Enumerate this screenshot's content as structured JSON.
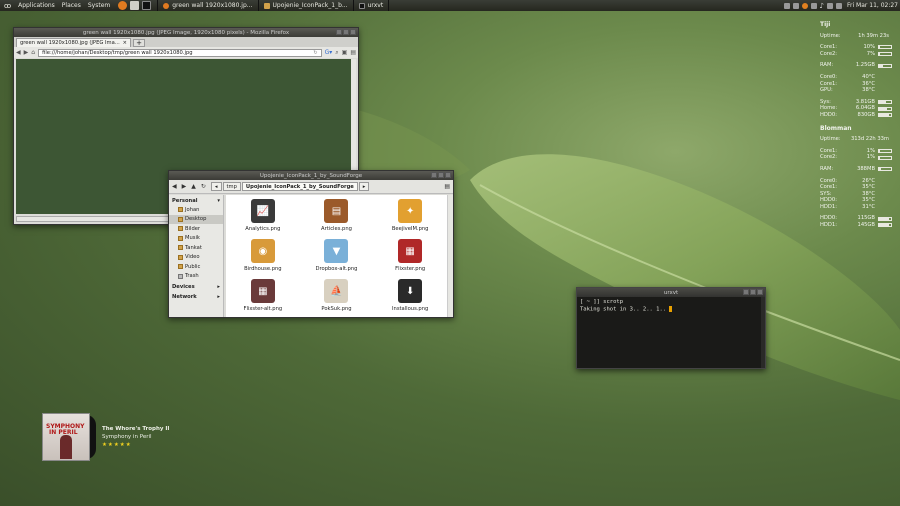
{
  "panel": {
    "menus": [
      "Applications",
      "Places",
      "System"
    ],
    "tasks": [
      "green wall 1920x1080.jp...",
      "Upojenie_IconPack_1_b...",
      "urxvt"
    ],
    "clock": "Fri Mar 11, 02:27"
  },
  "conky": {
    "host1": "Tiji",
    "uptime1_label": "Uptime:",
    "uptime1": "1h 39m 23s",
    "cpu1": [
      {
        "l": "Core1:",
        "v": "10%",
        "p": 0.1
      },
      {
        "l": "Core2:",
        "v": "7%",
        "p": 0.07
      }
    ],
    "ram1": {
      "l": "RAM:",
      "v": "1.25GB",
      "p": 0.3
    },
    "temps1": [
      {
        "l": "Core0:",
        "v": "40°C"
      },
      {
        "l": "Core1:",
        "v": "36°C"
      },
      {
        "l": "GPU:",
        "v": "38°C"
      }
    ],
    "disks1": [
      {
        "l": "Sys:",
        "v": "3.81GB",
        "p": 0.6
      },
      {
        "l": "Home:",
        "v": "6.04GB",
        "p": 0.7
      },
      {
        "l": "HDD0:",
        "v": "830GB",
        "p": 0.85
      }
    ],
    "host2": "Blomman",
    "uptime2_label": "Uptime:",
    "uptime2": "313d 22h 33m",
    "cpu2": [
      {
        "l": "Core1:",
        "v": "1%",
        "p": 0.01
      },
      {
        "l": "Core2:",
        "v": "1%",
        "p": 0.01
      }
    ],
    "ram2": {
      "l": "RAM:",
      "v": "388MB",
      "p": 0.15
    },
    "temps2": [
      {
        "l": "Core0:",
        "v": "26°C"
      },
      {
        "l": "Core1:",
        "v": "35°C"
      },
      {
        "l": "SYS:",
        "v": "38°C"
      },
      {
        "l": "HDD0:",
        "v": "35°C"
      },
      {
        "l": "HDD1:",
        "v": "31°C"
      }
    ],
    "disks2": [
      {
        "l": "HDD0:",
        "v": "115GB",
        "p": 0.8
      },
      {
        "l": "HDD1:",
        "v": "145GB",
        "p": 0.85
      }
    ]
  },
  "firefox": {
    "title": "green wall 1920x1080.jpg (JPEG Image, 1920x1080 pixels) - Mozilla Firefox",
    "tab": "green wall 1920x1080.jpg (JPEG Ima...",
    "url": "file:///home/johan/Desktop/tmp/green wall 1920x1080.jpg",
    "newtab": "+"
  },
  "nautilus": {
    "title": "Upojenie_IconPack_1_by_SoundForge",
    "crumbs": [
      "tmp",
      "Upojenie_IconPack_1_by_SoundForge"
    ],
    "sections": [
      "Personal",
      "Devices",
      "Network"
    ],
    "places": [
      "Johan",
      "Desktop",
      "Bilder",
      "Musik",
      "Tankat",
      "Video",
      "Public",
      "Trash"
    ],
    "files": [
      {
        "name": "Analytics.png",
        "color": "#3a3a3a",
        "glyph": "📈"
      },
      {
        "name": "Articles.png",
        "color": "#9b5a2a",
        "glyph": "▤"
      },
      {
        "name": "BeejiveIM.png",
        "color": "#e2a030",
        "glyph": "✦"
      },
      {
        "name": "Birdhouse.png",
        "color": "#d89a3a",
        "glyph": "◉"
      },
      {
        "name": "Dropbox-alt.png",
        "color": "#7ab0d8",
        "glyph": "▼"
      },
      {
        "name": "Flixster.png",
        "color": "#b02828",
        "glyph": "▦"
      },
      {
        "name": "Flixster-alt.png",
        "color": "#6a3a3a",
        "glyph": "▦"
      },
      {
        "name": "PokSuk.png",
        "color": "#d8d0c0",
        "glyph": "⛵"
      },
      {
        "name": "Installous.png",
        "color": "#2a2a2a",
        "glyph": "⬇"
      }
    ]
  },
  "terminal": {
    "title": "urxvt",
    "line1": "[ ~ ]] scrotp",
    "line2": "Taking shot in 3.. 2.. 1.. "
  },
  "player": {
    "cover_l1": "SYMPHONY",
    "cover_l2": "IN PERIL",
    "song": "The Whore's Trophy II",
    "album": "Symphony in Peril",
    "rating": "★★★★★"
  }
}
